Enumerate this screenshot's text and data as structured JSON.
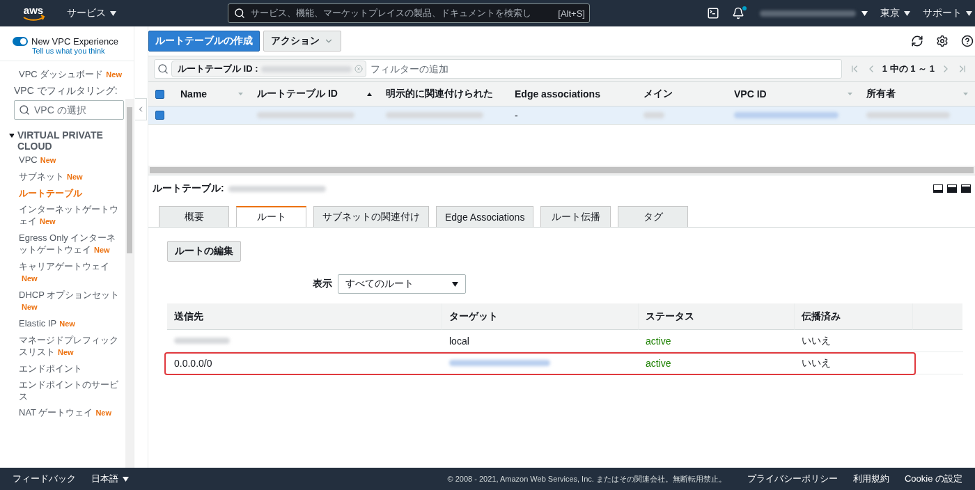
{
  "top_nav": {
    "logo": "aws",
    "services": "サービス",
    "search": {
      "placeholder": "サービス、機能、マーケットプレイスの製品、ドキュメントを検索し",
      "shortcut": "[Alt+S]"
    },
    "notification_dot": true,
    "region": "東京",
    "support": "サポート"
  },
  "sidebar": {
    "toggle": {
      "label": "New VPC Experience",
      "on": true
    },
    "feedback_link": "Tell us what you think",
    "dashboard": {
      "label": "VPC ダッシュボード",
      "badge": "New"
    },
    "filter_label": "VPC でフィルタリング:",
    "filter": {
      "placeholder": "VPC の選択"
    },
    "section": {
      "title": "VIRTUAL PRIVATE CLOUD",
      "expanded": true
    },
    "items": [
      {
        "label": "VPC",
        "badge": "New",
        "selected": false
      },
      {
        "label": "サブネット",
        "badge": "New",
        "selected": false
      },
      {
        "label": "ルートテーブル",
        "selected": true
      },
      {
        "label": "インターネットゲートウェイ",
        "badge": "New",
        "selected": false
      },
      {
        "label": "Egress Only インターネットゲートウェイ",
        "badge": "New",
        "selected": false
      },
      {
        "label": "キャリアゲートウェイ",
        "badge": "New",
        "selected": false
      },
      {
        "label": "DHCP オプションセット",
        "badge": "New",
        "selected": false
      },
      {
        "label": "Elastic IP",
        "badge": "New",
        "selected": false
      },
      {
        "label": "マネージドプレフィックスリスト",
        "badge": "New",
        "selected": false
      },
      {
        "label": "エンドポイント",
        "selected": false
      },
      {
        "label": "エンドポイントのサービス",
        "selected": false
      },
      {
        "label": "NAT ゲートウェイ",
        "badge": "New",
        "selected": false
      }
    ]
  },
  "toolbar": {
    "create_button": "ルートテーブルの作成",
    "actions_button": "アクション"
  },
  "filter_bar": {
    "token_label": "ルートテーブル ID :",
    "placeholder": "フィルターの追加",
    "pagination": "1 中の 1 ～ 1"
  },
  "table": {
    "select_all": {
      "checked": true
    },
    "columns": [
      {
        "label": "Name",
        "sorted": false
      },
      {
        "label": "ルートテーブル ID",
        "sorted": true
      },
      {
        "label": "明示的に関連付けられた"
      },
      {
        "label": "Edge associations"
      },
      {
        "label": "メイン"
      },
      {
        "label": "VPC ID",
        "sorted": false
      },
      {
        "label": "所有者",
        "sorted": false
      }
    ],
    "rows": [
      {
        "selected": true,
        "cells": [
          {
            "kind": "empty"
          },
          {
            "kind": "blurred"
          },
          {
            "kind": "blurred"
          },
          {
            "kind": "text",
            "text": "-"
          },
          {
            "kind": "blurred"
          },
          {
            "kind": "blurred_link"
          },
          {
            "kind": "blurred"
          }
        ]
      }
    ]
  },
  "details": {
    "title": "ルートテーブル:",
    "tabs": [
      {
        "label": "概要",
        "selected": false
      },
      {
        "label": "ルート",
        "selected": true
      },
      {
        "label": "サブネットの関連付け",
        "selected": false
      },
      {
        "label": "Edge Associations",
        "selected": false
      },
      {
        "label": "ルート伝播",
        "selected": false
      },
      {
        "label": "タグ",
        "selected": false
      }
    ],
    "edit_button": "ルートの編集",
    "view_label": "表示",
    "view_select": "すべてのルート",
    "routes": {
      "columns": [
        "送信先",
        "ターゲット",
        "ステータス",
        "伝播済み"
      ],
      "rows": [
        {
          "highlighted": false,
          "cells": [
            {
              "kind": "blurred"
            },
            {
              "kind": "text",
              "text": "local"
            },
            {
              "kind": "status",
              "text": "active"
            },
            {
              "kind": "text",
              "text": "いいえ"
            }
          ]
        },
        {
          "highlighted": true,
          "cells": [
            {
              "kind": "text",
              "text": "0.0.0.0/0"
            },
            {
              "kind": "blurred_link"
            },
            {
              "kind": "status",
              "text": "active"
            },
            {
              "kind": "text",
              "text": "いいえ"
            }
          ]
        }
      ]
    }
  },
  "footer": {
    "feedback": "フィードバック",
    "language": "日本語",
    "copyright": "© 2008 - 2021, Amazon Web Services, Inc. またはその関連会社。無断転用禁止。",
    "links": [
      "プライバシーポリシー",
      "利用規約",
      "Cookie の設定"
    ]
  }
}
